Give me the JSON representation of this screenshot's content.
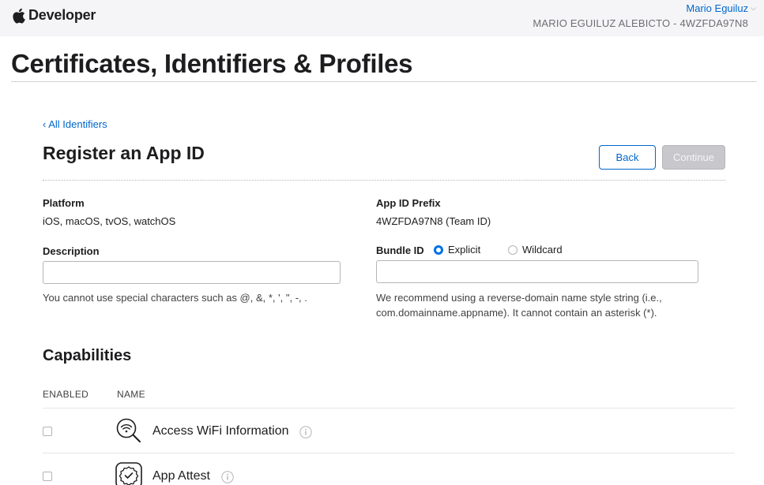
{
  "header": {
    "brand": "Developer",
    "user_name": "Mario Eguiluz",
    "team_line": "MARIO EGUILUZ ALEBICTO - 4WZFDA97N8"
  },
  "page_title": "Certificates, Identifiers & Profiles",
  "back_link": "‹ All Identifiers",
  "section_title": "Register an App ID",
  "buttons": {
    "back": "Back",
    "continue": "Continue"
  },
  "form": {
    "platform_label": "Platform",
    "platform_value": "iOS, macOS, tvOS, watchOS",
    "app_id_prefix_label": "App ID Prefix",
    "app_id_prefix_value": "4WZFDA97N8 (Team ID)",
    "description_label": "Description",
    "description_value": "",
    "description_hint": "You cannot use special characters such as @, &, *, ', \", -, .",
    "bundle_id_label": "Bundle ID",
    "bundle_id_options": [
      "Explicit",
      "Wildcard"
    ],
    "bundle_id_selected": "Explicit",
    "bundle_id_value": "",
    "bundle_id_hint_line1": "We recommend using a reverse-domain name style string (i.e.,",
    "bundle_id_hint_line2": "com.domainname.appname). It cannot contain an asterisk (*)."
  },
  "capabilities": {
    "title": "Capabilities",
    "columns": [
      "ENABLED",
      "NAME"
    ],
    "items": [
      {
        "name": "Access WiFi Information",
        "enabled": false,
        "icon": "wifi-search-icon"
      },
      {
        "name": "App Attest",
        "enabled": false,
        "icon": "verified-badge-icon"
      }
    ]
  },
  "colors": {
    "accent": "#0066cc",
    "radio_selected": "#0071e3",
    "topbar_bg": "#f5f5f7",
    "disabled_button": "#c7c7cc"
  }
}
